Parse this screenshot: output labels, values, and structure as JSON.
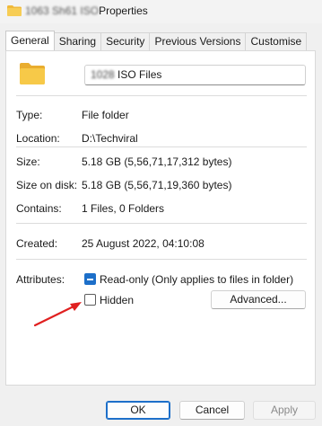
{
  "window": {
    "title_blurred": "1063 Sh61 ISO",
    "title_suffix": "Properties"
  },
  "tabs": [
    "General",
    "Sharing",
    "Security",
    "Previous Versions",
    "Customise"
  ],
  "name": {
    "blurred": "1028",
    "text": "ISO Files"
  },
  "details": {
    "type_label": "Type:",
    "type_value": "File folder",
    "location_label": "Location:",
    "location_value": "D:\\Techviral",
    "size_label": "Size:",
    "size_value": "5.18 GB (5,56,71,17,312 bytes)",
    "size_on_disk_label": "Size on disk:",
    "size_on_disk_value": "5.18 GB (5,56,71,19,360 bytes)",
    "contains_label": "Contains:",
    "contains_value": "1 Files, 0 Folders",
    "created_label": "Created:",
    "created_value": "25 August 2022, 04:10:08"
  },
  "attributes": {
    "label": "Attributes:",
    "readonly_label": "Read-only (Only applies to files in folder)",
    "readonly_state": "indeterminate",
    "hidden_label": "Hidden",
    "hidden_checked": false,
    "advanced_label": "Advanced..."
  },
  "buttons": {
    "ok": "OK",
    "cancel": "Cancel",
    "apply": "Apply"
  },
  "colors": {
    "accent": "#1d6fc9",
    "annotation_arrow": "#e02020",
    "folder": "#f5c94a"
  },
  "icons": {
    "title": "folder-icon",
    "large": "folder-icon",
    "annotation": "red-arrow"
  }
}
